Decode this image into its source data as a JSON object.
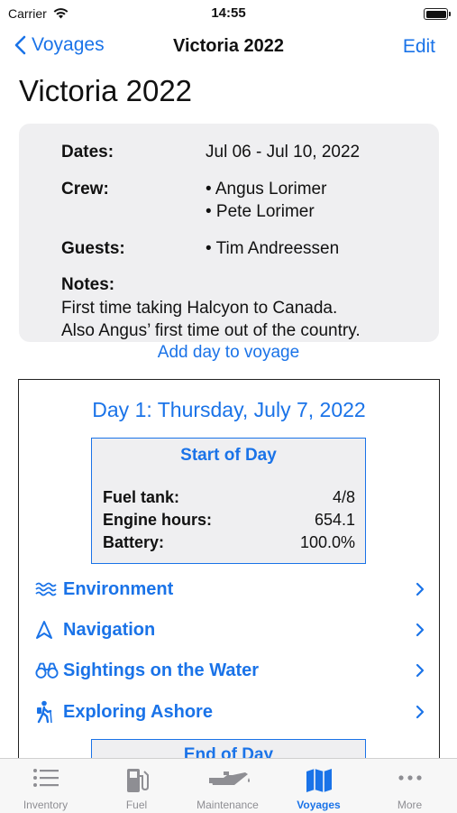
{
  "status": {
    "carrier": "Carrier",
    "time": "14:55"
  },
  "nav": {
    "back_label": "Voyages",
    "title": "Victoria 2022",
    "edit_label": "Edit"
  },
  "page_title": "Victoria 2022",
  "info": {
    "dates_label": "Dates:",
    "dates_value": "Jul 06 - Jul 10, 2022",
    "crew_label": "Crew:",
    "crew": [
      "• Angus Lorimer",
      "• Pete Lorimer"
    ],
    "guests_label": "Guests:",
    "guests": [
      "• Tim Andreessen"
    ],
    "notes_label": "Notes:",
    "notes_lines": [
      "First time taking Halcyon to Canada.",
      "Also Angus’ first time out of the country."
    ]
  },
  "add_day_label": "Add day to voyage",
  "day": {
    "title": "Day 1: Thursday, July 7, 2022",
    "start": {
      "title": "Start of Day",
      "rows": [
        {
          "label": "Fuel tank:",
          "value": "4/8"
        },
        {
          "label": "Engine hours:",
          "value": "654.1"
        },
        {
          "label": "Battery:",
          "value": "100.0%"
        }
      ]
    },
    "sections": [
      {
        "label": "Environment",
        "icon": "waves-icon"
      },
      {
        "label": "Navigation",
        "icon": "navigation-icon"
      },
      {
        "label": "Sightings on the Water",
        "icon": "binoculars-icon"
      },
      {
        "label": "Exploring Ashore",
        "icon": "hiker-icon"
      }
    ],
    "end_title": "End of Day"
  },
  "tabs": [
    {
      "label": "Inventory",
      "icon": "list-icon"
    },
    {
      "label": "Fuel",
      "icon": "fuel-pump-icon"
    },
    {
      "label": "Maintenance",
      "icon": "oil-can-icon"
    },
    {
      "label": "Voyages",
      "icon": "map-icon",
      "active": true
    },
    {
      "label": "More",
      "icon": "ellipsis-icon"
    }
  ],
  "colors": {
    "accent": "#1a73e8",
    "card_bg": "#efeff1",
    "inactive_tab": "#8e8e93"
  }
}
